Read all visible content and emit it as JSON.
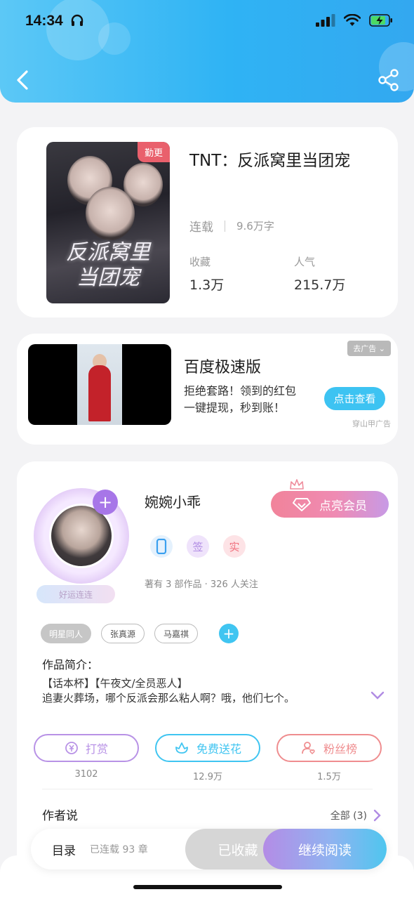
{
  "status_bar": {
    "time": "14:34"
  },
  "book": {
    "cover_badge": "勤更",
    "cover_art_title_line1": "反派窝里",
    "cover_art_title_line2": "当团宠",
    "title": "TNT：反派窝里当团宠",
    "status": "连载",
    "word_count": "9.6万字",
    "favorites_label": "收藏",
    "favorites_value": "1.3万",
    "popularity_label": "人气",
    "popularity_value": "215.7万"
  },
  "ad": {
    "app_name": "百度极速版",
    "desc_line1": "拒绝套路！领到的红包",
    "desc_line2": "一键提现，秒到账！",
    "cta": "点击查看",
    "dismiss_label": "去广告",
    "source": "穿山甲广告"
  },
  "author": {
    "name": "婉婉小乖",
    "luck_tag": "好运连连",
    "vip_button": "点亮会员",
    "badges": [
      {
        "icon": "phone-badge-icon",
        "text": "",
        "color": "#3aa0ef"
      },
      {
        "icon": "signed-badge-icon",
        "text": "签",
        "color": "#b08be3"
      },
      {
        "icon": "verified-badge-icon",
        "text": "实",
        "color": "#f0707e"
      }
    ],
    "subtitle": "著有 3 部作品 · 326 人关注",
    "tags": [
      "明星同人",
      "张真源",
      "马嘉祺"
    ],
    "intro_heading": "作品简介：",
    "intro_line1": "【话本杯】【午夜文/全员恶人】",
    "intro_line2": "追妻火葬场，哪个反派会那么粘人啊？哦，他们七个。",
    "actions": [
      {
        "label": "打赏",
        "count": "3102",
        "color": "#b892e6"
      },
      {
        "label": "免费送花",
        "count": "12.9万",
        "color": "#40c5f1"
      },
      {
        "label": "粉丝榜",
        "count": "1.5万",
        "color": "#ef8d8f"
      }
    ],
    "author_says_heading": "作者说",
    "author_says_all": "全部 (3)"
  },
  "bottom_bar": {
    "toc": "目录",
    "chapters": "已连载 93 章",
    "favorited": "已收藏",
    "continue_reading": "继续阅读"
  },
  "colors": {
    "header_gradient_start": "#5cc8f6",
    "header_gradient_end": "#33a8f0",
    "accent_blue": "#40c5f1",
    "accent_purple": "#a776e8"
  }
}
